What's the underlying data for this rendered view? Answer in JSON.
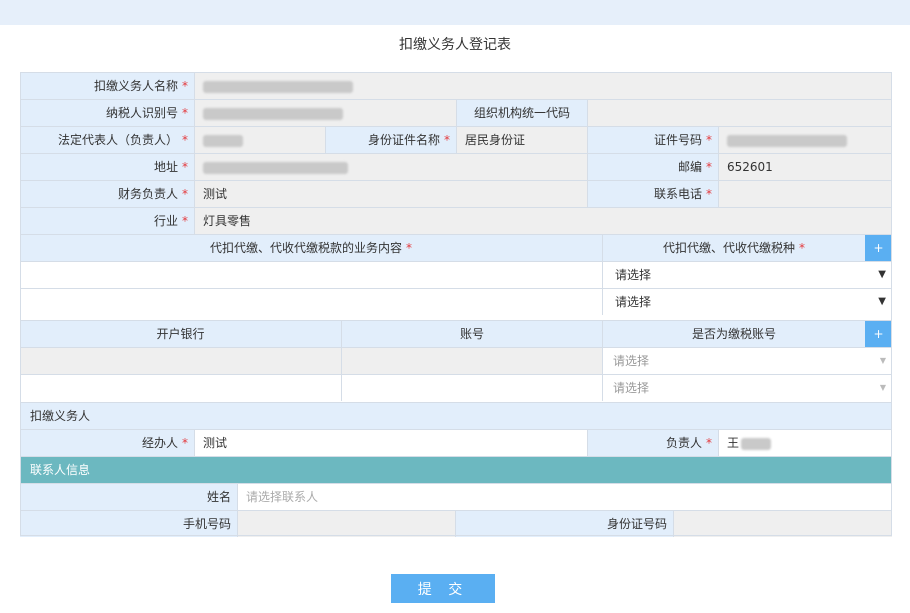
{
  "title": "扣缴义务人登记表",
  "required_mark": "*",
  "labels": {
    "withholder_name": "扣缴义务人名称",
    "taxpayer_id": "纳税人识别号",
    "org_code": "组织机构统一代码",
    "legal_rep": "法定代表人（负责人）",
    "id_doc_name": "身份证件名称",
    "id_doc_number": "证件号码",
    "address": "地址",
    "postcode": "邮编",
    "finance_head": "财务负责人",
    "phone": "联系电话",
    "industry": "行业",
    "business_content": "代扣代缴、代收代缴税款的业务内容",
    "tax_type": "代扣代缴、代收代缴税种",
    "bank": "开户银行",
    "account": "账号",
    "is_tax_account": "是否为缴税账号",
    "withholder_section": "扣缴义务人",
    "handler": "经办人",
    "principal": "负责人",
    "contact_section": "联系人信息",
    "contact_name": "姓名",
    "mobile": "手机号码",
    "id_number": "身份证号码"
  },
  "values": {
    "id_doc_name": "居民身份证",
    "postcode": "652601",
    "finance_head": "测试",
    "industry": "灯具零售",
    "handler": "测试",
    "principal": "王"
  },
  "placeholders": {
    "select": "请选择",
    "contact_name": "请选择联系人"
  },
  "buttons": {
    "plus": "+",
    "submit": "提 交"
  },
  "colors": {
    "label_bg": "#e2eefb",
    "accent": "#5aaff2",
    "section_teal": "#6cb8c0",
    "required": "#e4393c"
  }
}
